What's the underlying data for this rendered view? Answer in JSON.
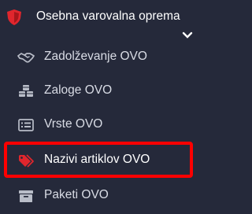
{
  "menu": {
    "title": "Osebna varovalna oprema",
    "icon": "shield-icon",
    "accent_color": "#e0262d",
    "expanded": true,
    "items": [
      {
        "label": "Zadolževanje OVO",
        "icon": "handshake-icon",
        "active": false
      },
      {
        "label": "Zaloge OVO",
        "icon": "cubes-icon",
        "active": false
      },
      {
        "label": "Vrste OVO",
        "icon": "list-icon",
        "active": false
      },
      {
        "label": "Nazivi artiklov OVO",
        "icon": "tags-icon",
        "active": true
      },
      {
        "label": "Paketi OVO",
        "icon": "archive-box-icon",
        "active": false
      }
    ]
  },
  "highlight_color": "#ff0000"
}
